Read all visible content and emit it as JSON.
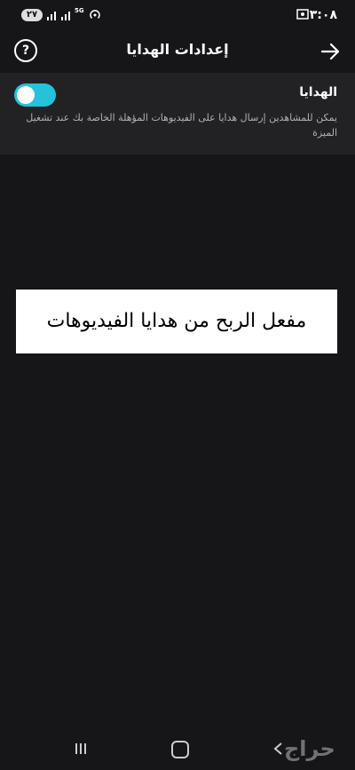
{
  "status_bar": {
    "time": "٣:٠٨",
    "battery": "٢٧",
    "network": "5G"
  },
  "header": {
    "title": "إعدادات الهدايا",
    "help_label": "?"
  },
  "gifts_setting": {
    "title": "الهدايا",
    "description": "يمكن للمشاهدين إرسال هدايا على الفيديوهات المؤهلة الخاصة بك عند تشغيل الميزة",
    "toggle_on": true,
    "toggle_color": "#25c2dc"
  },
  "overlay": {
    "text": "مفعل الربح من هدايا الفيديوهات"
  },
  "nav_bar": {
    "watermark": "حراج"
  },
  "icons": [
    "arrow-right-icon",
    "question-mark-icon",
    "screen-record-icon",
    "signal-icon",
    "hotspot-icon",
    "recents-icon",
    "home-icon",
    "back-icon"
  ]
}
